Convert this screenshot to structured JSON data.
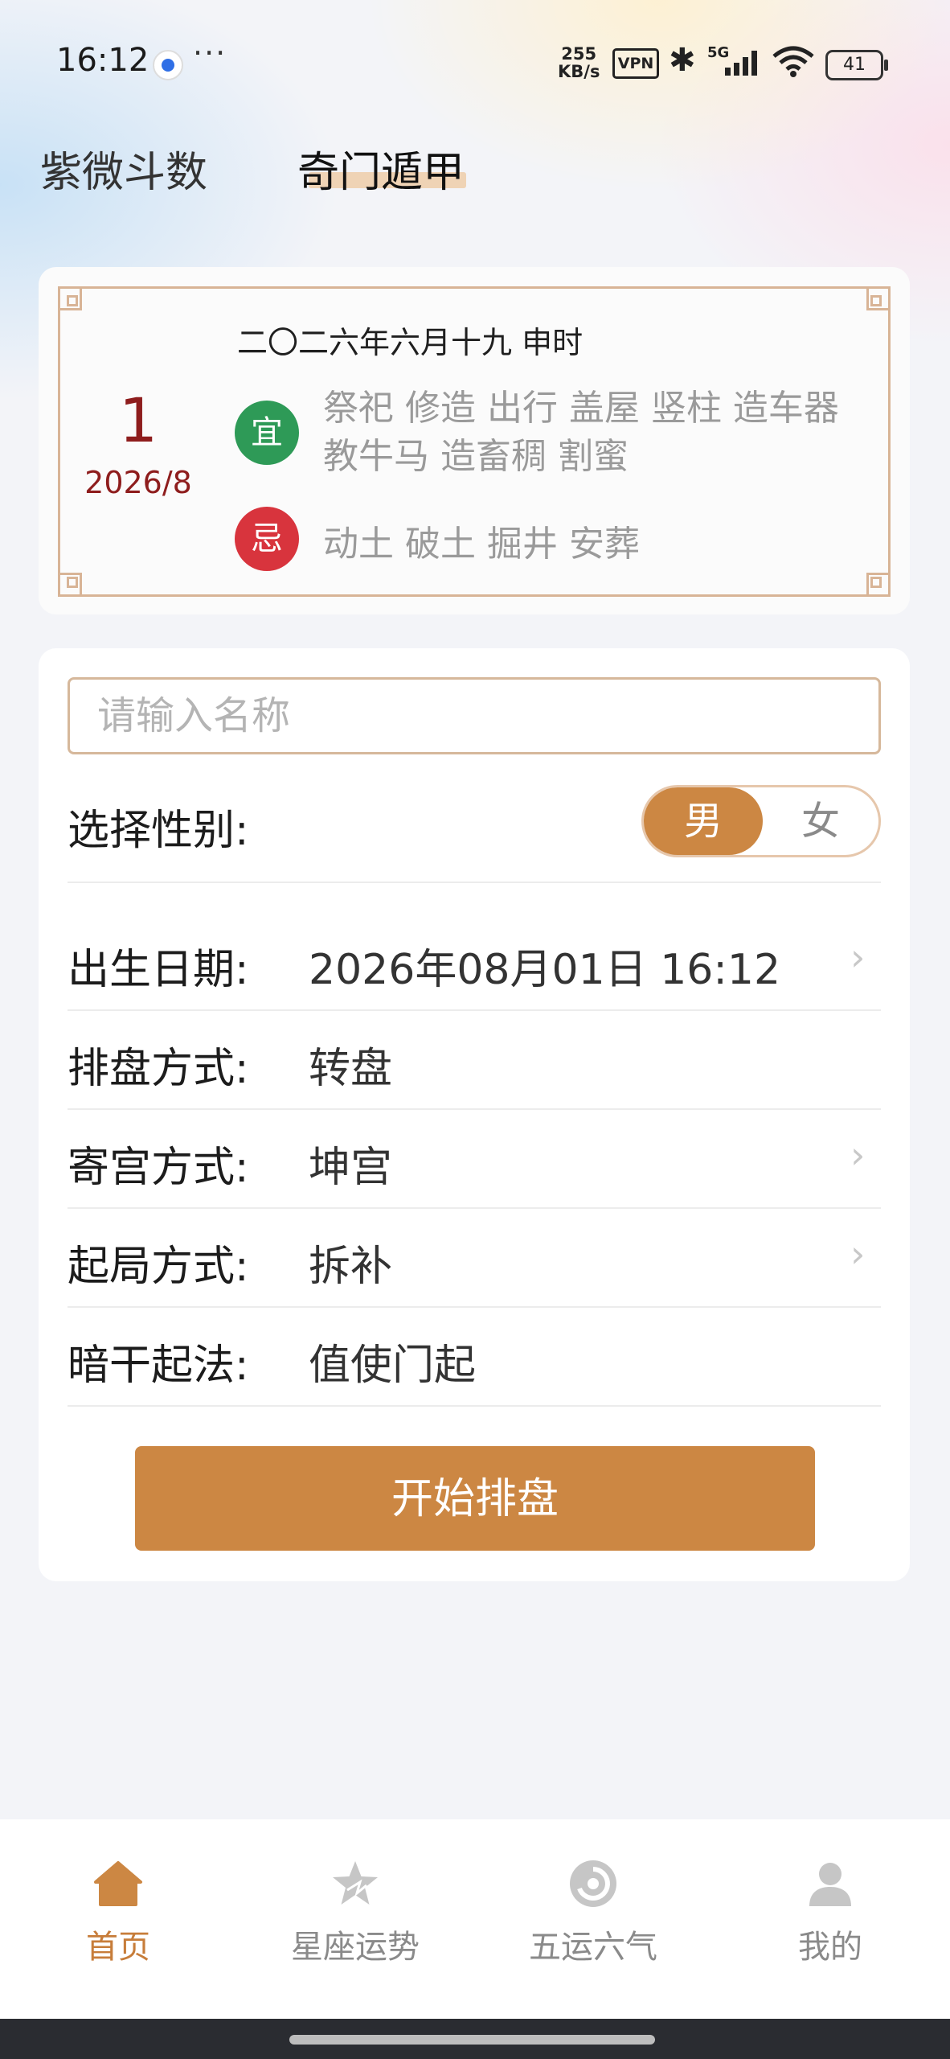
{
  "status_bar": {
    "time": "16:12",
    "more": "···",
    "speed_top": "255",
    "speed_bottom": "KB/s",
    "vpn": "VPN",
    "network": "5G",
    "battery": "41"
  },
  "top_tabs": [
    {
      "label": "紫微斗数",
      "active": false
    },
    {
      "label": "奇门遁甲",
      "active": true
    }
  ],
  "almanac": {
    "day": "1",
    "date": "2026/8",
    "lunar": "二〇二六年六月十九 申时",
    "yi_icon": "宜",
    "yi_text": "祭祀 修造 出行 盖屋 竖柱 造车器 教牛马 造畜稠 割蜜",
    "ji_icon": "忌",
    "ji_text": "动土 破土 掘井 安葬"
  },
  "form": {
    "name_placeholder": "请输入名称",
    "gender_label": "选择性别:",
    "gender_options": [
      "男",
      "女"
    ],
    "gender_selected": "男",
    "rows": [
      {
        "label": "出生日期:",
        "value": "2026年08月01日 16:12"
      },
      {
        "label": "排盘方式:",
        "value": "转盘"
      },
      {
        "label": "寄宫方式:",
        "value": "坤宫"
      },
      {
        "label": "起局方式:",
        "value": "拆补"
      },
      {
        "label": "暗干起法:",
        "value": "值使门起"
      }
    ],
    "submit_label": "开始排盘"
  },
  "bottom_nav": [
    {
      "label": "首页",
      "icon": "home-icon",
      "active": true
    },
    {
      "label": "星座运势",
      "icon": "star-icon",
      "active": false
    },
    {
      "label": "五运六气",
      "icon": "cycle-icon",
      "active": false
    },
    {
      "label": "我的",
      "icon": "user-icon",
      "active": false
    }
  ],
  "colors": {
    "accent": "#cc8743",
    "yi_green": "#2e9a57",
    "ji_red": "#d8343d",
    "date_red": "#8e1d1d"
  }
}
